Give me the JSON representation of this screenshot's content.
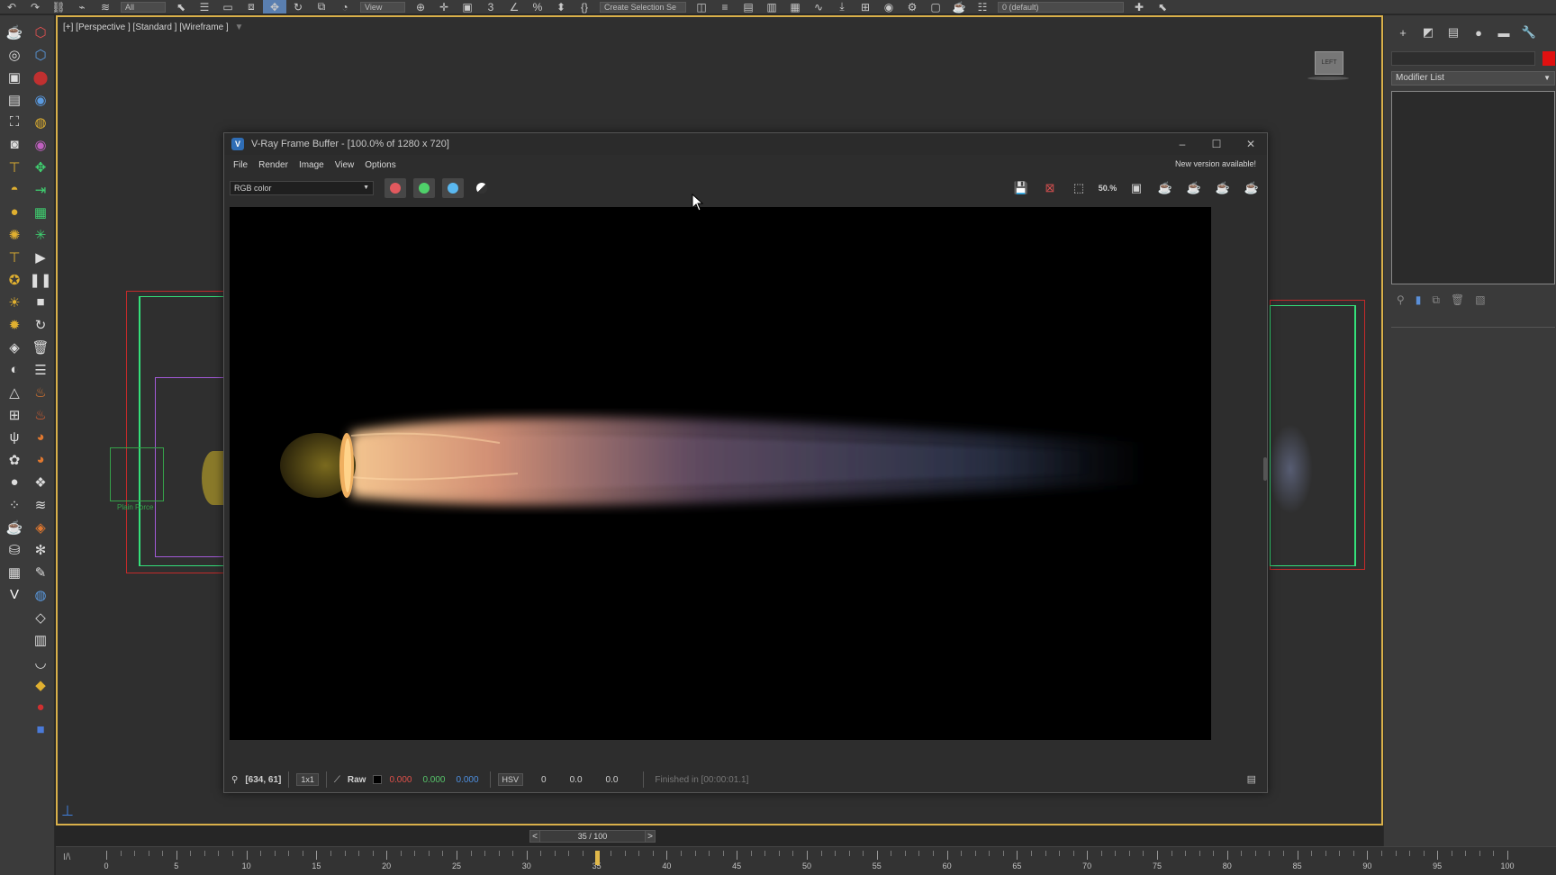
{
  "top_toolbar": {
    "selection_filter": "All",
    "view_dropdown": "View",
    "selection_set": "Create Selection Se",
    "layer_dropdown": "0 (default)"
  },
  "viewport": {
    "label": "[+] [Perspective ] [Standard ] [Wireframe ]",
    "filter_icon": "funnel-icon",
    "viewcube_label": "LEFT",
    "plain_force_label": "Plain Force"
  },
  "vfb": {
    "title": "V-Ray Frame Buffer - [100.0% of 1280 x 720]",
    "menu": [
      "File",
      "Render",
      "Image",
      "View",
      "Options"
    ],
    "new_version": "New version available!",
    "channel": "RGB color",
    "channel_colors": {
      "red": "#e2595e",
      "green": "#4fd16a",
      "blue": "#5ab8f0"
    },
    "zoom_text": "50.%",
    "status": {
      "coords": "[634, 61]",
      "sample": "1x1",
      "raw": "Raw",
      "r": "0.000",
      "g": "0.000",
      "b": "0.000",
      "mode": "HSV",
      "h": "0",
      "s": "0.0",
      "v": "0.0",
      "finished": "Finished in [00:00:01.1]"
    }
  },
  "right_panel": {
    "modifier_list": "Modifier List",
    "object_color": "#e01010"
  },
  "timeline": {
    "prev": "<",
    "next": ">",
    "frame_display": "35 / 100",
    "current_frame": 35,
    "corner": "I/\\",
    "ticks": [
      "0",
      "5",
      "10",
      "15",
      "20",
      "25",
      "30",
      "35",
      "40",
      "45",
      "50",
      "55",
      "60",
      "65",
      "70",
      "75",
      "80",
      "85",
      "90",
      "95",
      "100"
    ]
  }
}
